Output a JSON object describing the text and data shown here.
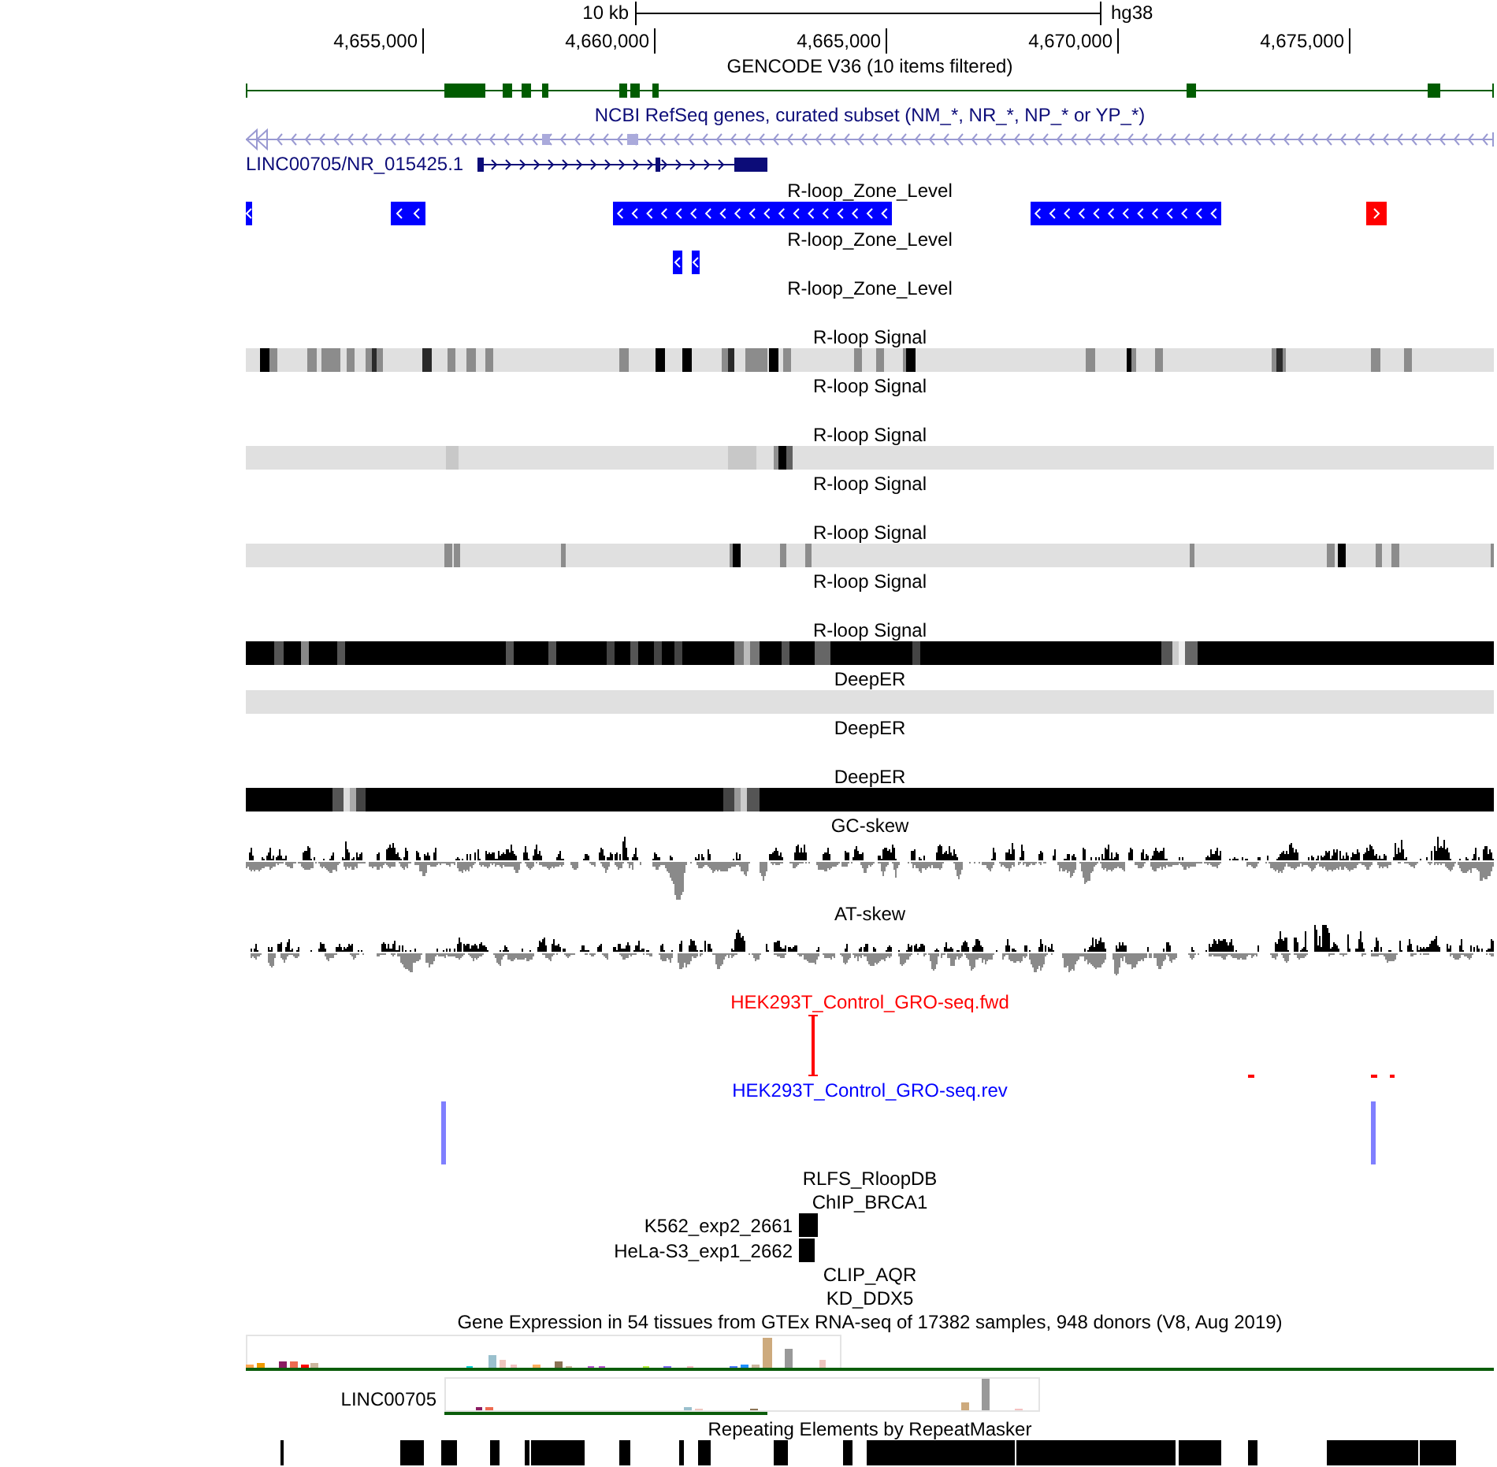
{
  "ruler": {
    "scale_label": "10 kb",
    "assembly": "hg38",
    "positions": [
      "4,655,000",
      "4,660,000",
      "4,665,000",
      "4,670,000",
      "4,675,000"
    ]
  },
  "tracks": [
    {
      "kind": "gencode",
      "title": "GENCODE V36 (10 items filtered)"
    },
    {
      "kind": "refseq",
      "title": "NCBI RefSeq genes, curated subset (NM_*, NR_*, NP_* or YP_*)",
      "gene_label": "LINC00705/NR_015425.1"
    },
    {
      "kind": "zones",
      "title": "R-loop_Zone_Level",
      "features": [
        {
          "reverse": true
        },
        {
          "reverse": true
        },
        {
          "reverse": true
        },
        {
          "reverse": true
        },
        {
          "reverse": false
        }
      ]
    },
    {
      "kind": "zones",
      "title": "R-loop_Zone_Level",
      "features": [
        {
          "reverse": true
        },
        {
          "reverse": true
        }
      ]
    },
    {
      "kind": "zones",
      "title": "R-loop_Zone_Level"
    },
    {
      "kind": "heatmap",
      "title": "R-loop Signal"
    },
    {
      "kind": "empty",
      "title": "R-loop Signal"
    },
    {
      "kind": "heatmap",
      "title": "R-loop Signal"
    },
    {
      "kind": "empty",
      "title": "R-loop Signal"
    },
    {
      "kind": "heatmap",
      "title": "R-loop Signal"
    },
    {
      "kind": "empty",
      "title": "R-loop Signal"
    },
    {
      "kind": "heatmap",
      "title": "R-loop Signal"
    },
    {
      "kind": "heatmap",
      "title": "DeepER"
    },
    {
      "kind": "empty",
      "title": "DeepER"
    },
    {
      "kind": "heatmap",
      "title": "DeepER"
    },
    {
      "kind": "wiggle",
      "title": "GC-skew"
    },
    {
      "kind": "wiggle",
      "title": "AT-skew"
    },
    {
      "kind": "gro_forward",
      "title": "HEK293T_Control_GRO-seq.fwd"
    },
    {
      "kind": "gro_reverse",
      "title": "HEK293T_Control_GRO-seq.rev"
    },
    {
      "kind": "collapsed",
      "title": "RLFS_RloopDB"
    },
    {
      "kind": "chip",
      "title": "ChIP_BRCA1",
      "rows": [
        "K562_exp2_2661",
        "HeLa-S3_exp1_2662"
      ]
    },
    {
      "kind": "collapsed",
      "title": "CLIP_AQR"
    },
    {
      "kind": "collapsed",
      "title": "KD_DDX5"
    },
    {
      "kind": "gtex",
      "title": "Gene Expression in 54 tissues from GTEx RNA-seq of 17382 samples, 948 donors (V8, Aug 2019)",
      "gene_label": "LINC00705"
    },
    {
      "kind": "repeats",
      "title": "Repeating Elements by RepeatMasker"
    }
  ]
}
